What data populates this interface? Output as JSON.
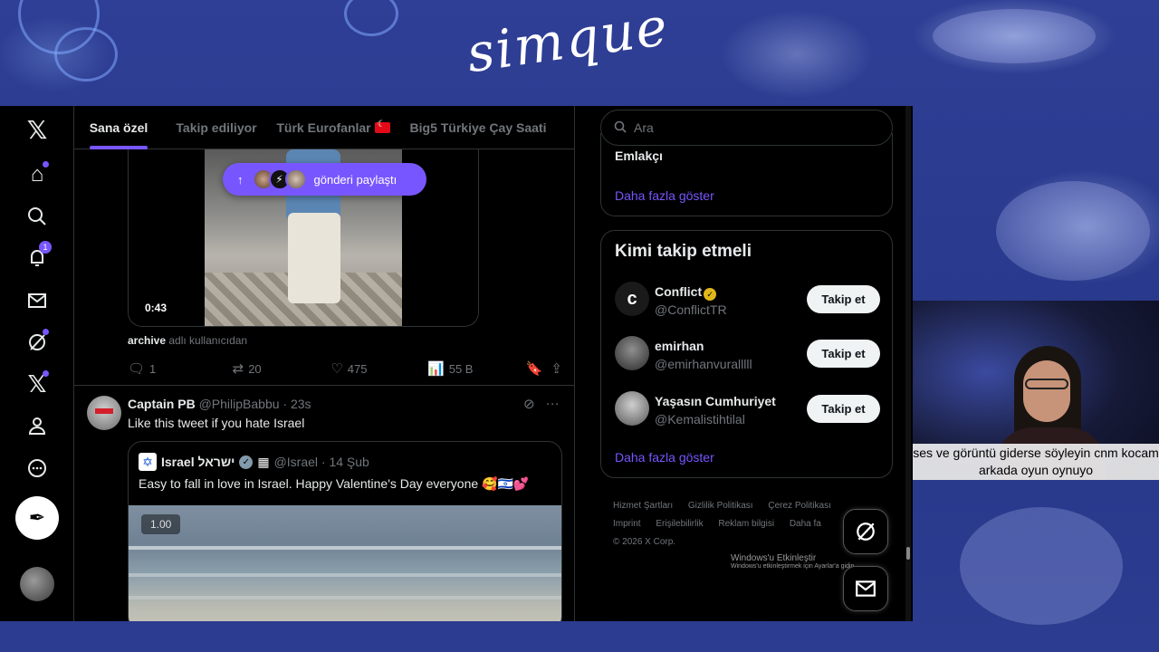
{
  "overlay": {
    "logo_text": "simque"
  },
  "nav": {
    "notification_count": "1"
  },
  "tabs": [
    {
      "label": "Sana özel",
      "active": true
    },
    {
      "label": "Takip ediliyor",
      "active": false
    },
    {
      "label": "Türk Eurofanlar",
      "active": false
    },
    {
      "label": "Big5 Türkiye Çay Saati",
      "active": false
    }
  ],
  "post1": {
    "video_time": "0:43",
    "shared_pill": "gönderi paylaştı",
    "source_user": "archive",
    "source_suffix": "adlı kullanıcıdan",
    "replies": "1",
    "reposts": "20",
    "likes": "475",
    "views": "55 B"
  },
  "post2": {
    "name": "Captain PB",
    "handle": "@PhilipBabbu · 23s",
    "text": "Like this tweet if you hate Israel",
    "quote": {
      "name": "Israel ישראל",
      "handle": "@Israel · 14 Şub",
      "text": "Easy to fall in love in Israel. Happy Valentine's Day everyone 🥰🇮🇱💕",
      "speed": "1.00"
    }
  },
  "right": {
    "search_placeholder": "Ara",
    "trend_item": "Emlakçı",
    "show_more": "Daha fazla göster",
    "who_to_follow_title": "Kimi takip etmeli",
    "suggestions": [
      {
        "name": "Conflict",
        "handle": "@ConflictTR",
        "button": "Takip et"
      },
      {
        "name": "emirhan",
        "handle": "@emirhanvuralllll",
        "button": "Takip et"
      },
      {
        "name": "Yaşasın Cumhuriyet",
        "handle": "@Kemalistihtilal",
        "button": "Takip et"
      }
    ],
    "show_more_2": "Daha fazla göster",
    "footer": {
      "links_row1": [
        "Hizmet Şartları",
        "Gizlilik Politikası",
        "Çerez Politikası"
      ],
      "links_row2": [
        "Imprint",
        "Erişilebilirlik",
        "Reklam bilgisi",
        "Daha fa"
      ],
      "copyright": "© 2026 X Corp."
    },
    "windows_activation": "Windows'u Etkinleştir",
    "windows_activation_sub": "Windows'u etkinleştirmek için Ayarlar'a gidin."
  },
  "webcam": {
    "caption": "ses ve görüntü giderse söyleyin cnm kocam arkada oyun oynuyo"
  },
  "colors": {
    "accent": "#7856ff",
    "overlay_bg": "#2a3a8c"
  }
}
